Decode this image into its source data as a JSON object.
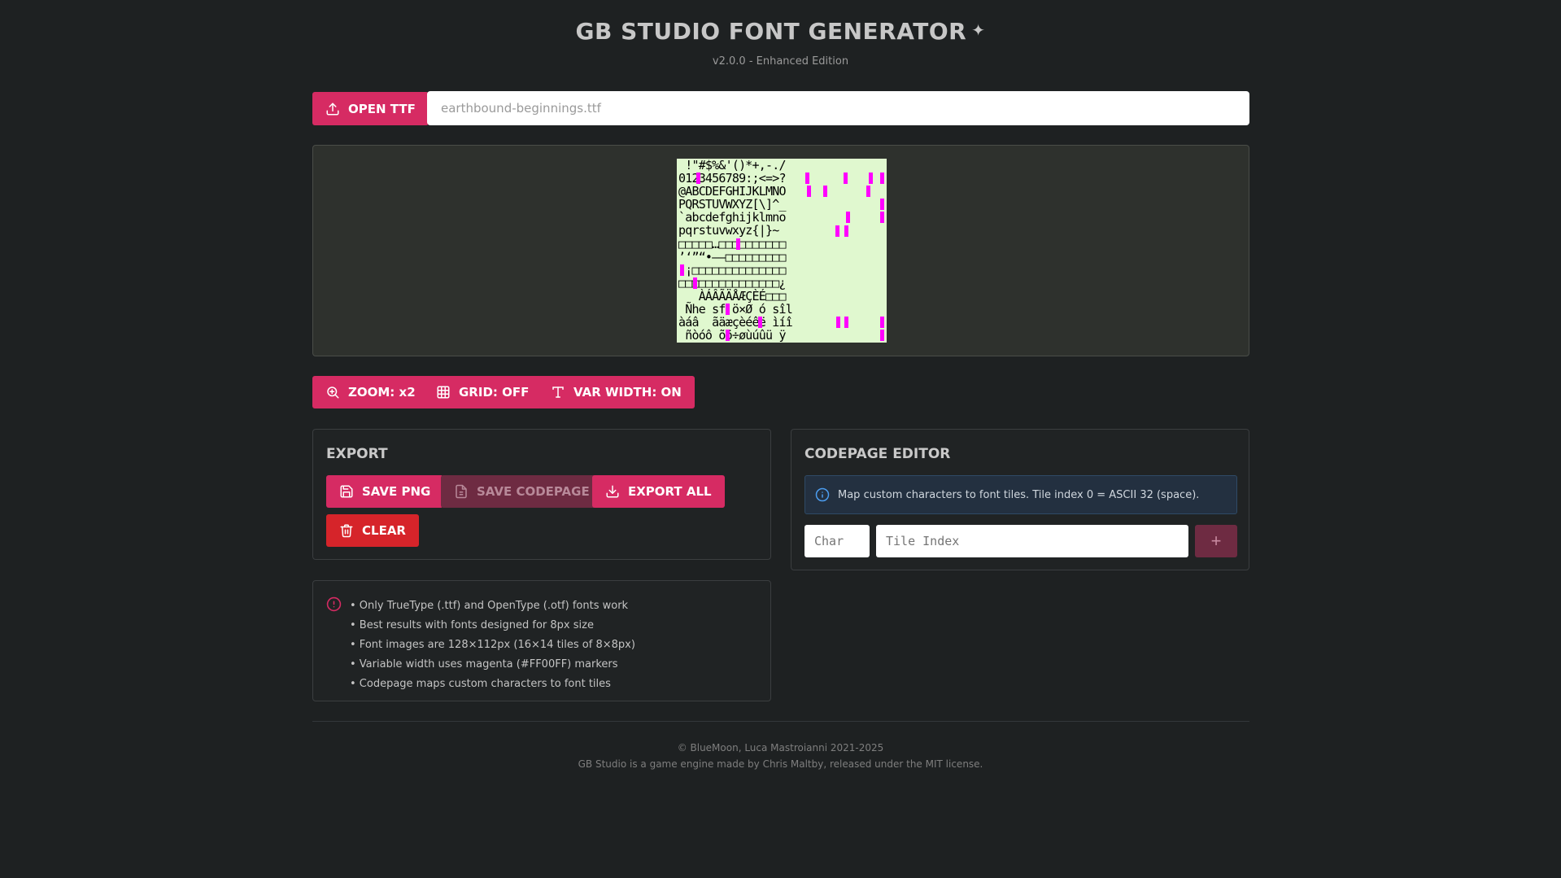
{
  "header": {
    "title": "GB STUDIO FONT GENERATOR",
    "title_mark": "✦",
    "subtitle": "v2.0.0 - Enhanced Edition"
  },
  "file": {
    "open_label": "OPEN TTF",
    "filename": "earthbound-beginnings.ttf"
  },
  "preview": {
    "rows": [
      " !\"#$%&'()*+,-./",
      "0123456789:;<=>?",
      "@ABCDEFGHIJKLMNO",
      "PQRSTUVWXYZ[\\]^_",
      "`abcdefghijklmno",
      "pqrstuvwxyz{|}~ ",
      "□□□□□…□□□□□□□□□□",
      "’‘”“•–—□□□□□□□□□",
      " ¡□□□□□□□□□□□□□□",
      "□□□□□□□□□□□□□□□¿",
      "   ÀÁÂÃÄÅÆÇÈÉ□□□",
      " Ñhe sf ö×Ø ó sîl",
      "àáâ  ãäæçèéêë ìíî",
      " ñòóô õö÷øùúûü ÿ"
    ],
    "bg_color": "#e0f8cf",
    "marker_color": "#ff00ff"
  },
  "toolbar": {
    "zoom_label": "ZOOM: x2",
    "grid_label": "GRID: OFF",
    "varwidth_label": "VAR WIDTH: ON"
  },
  "export": {
    "title": "EXPORT",
    "save_png": "SAVE PNG",
    "save_codepage": "SAVE CODEPAGE",
    "export_all": "EXPORT ALL",
    "clear": "CLEAR"
  },
  "codepage": {
    "title": "CODEPAGE EDITOR",
    "info": "Map custom characters to font tiles. Tile index 0 = ASCII 32 (space).",
    "char_placeholder": "Char",
    "tile_placeholder": "Tile Index",
    "add_label": "+"
  },
  "tips": [
    "• Only TrueType (.ttf) and OpenType (.otf) fonts work",
    "• Best results with fonts designed for 8px size",
    "• Font images are 128×112px (16×14 tiles of 8×8px)",
    "• Variable width uses magenta (#FF00FF) markers",
    "• Codepage maps custom characters to font tiles"
  ],
  "footer": {
    "copyright": "© BlueMoon, Luca Mastroianni 2021-2025",
    "note": "GB Studio is a game engine made by Chris Maltby, released under the MIT license."
  },
  "colors": {
    "accent": "#d62b63",
    "danger": "#d6242a",
    "background": "#1e2122"
  }
}
